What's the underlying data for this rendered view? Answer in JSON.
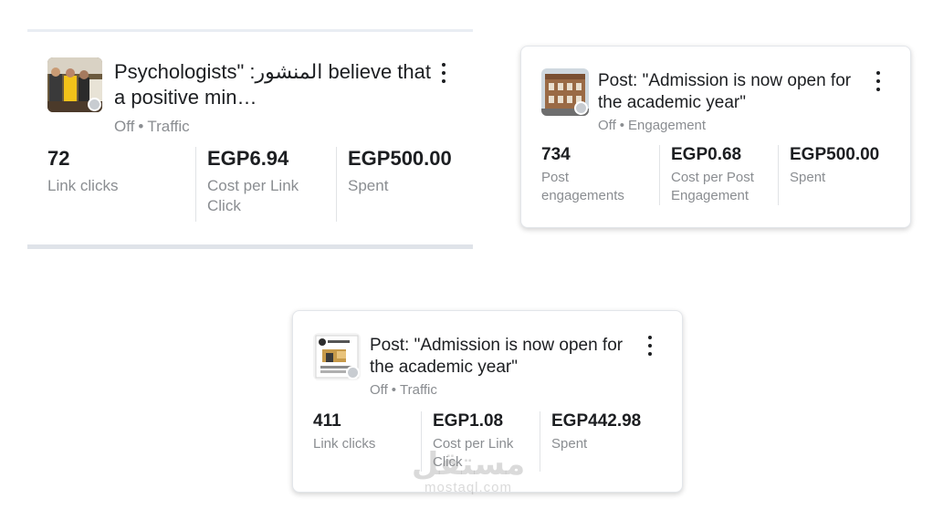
{
  "cards": [
    {
      "title": "Psychologists\" :المنشور believe that a positive min…",
      "status": "Off",
      "objective": "Traffic",
      "metrics": [
        {
          "value": "72",
          "label": "Link clicks"
        },
        {
          "value": "EGP6.94",
          "label": "Cost per Link Click"
        },
        {
          "value": "EGP500.00",
          "label": "Spent"
        }
      ]
    },
    {
      "title": "Post: \"Admission is now open for the academic year\"",
      "status": "Off",
      "objective": "Engagement",
      "metrics": [
        {
          "value": "734",
          "label": "Post engagements"
        },
        {
          "value": "EGP0.68",
          "label": "Cost per Post Engagement"
        },
        {
          "value": "EGP500.00",
          "label": "Spent"
        }
      ]
    },
    {
      "title": "Post: \"Admission is now open for the academic year\"",
      "status": "Off",
      "objective": "Traffic",
      "metrics": [
        {
          "value": "411",
          "label": "Link clicks"
        },
        {
          "value": "EGP1.08",
          "label": "Cost per Link Click"
        },
        {
          "value": "EGP442.98",
          "label": "Spent"
        }
      ]
    }
  ],
  "separator": "•",
  "watermark": {
    "logo": "مستقل",
    "text": "mostaql.com"
  },
  "colors": {
    "status_off": "#c8ccd1",
    "muted_text": "#8a8d91",
    "primary_text": "#1c1e21"
  }
}
